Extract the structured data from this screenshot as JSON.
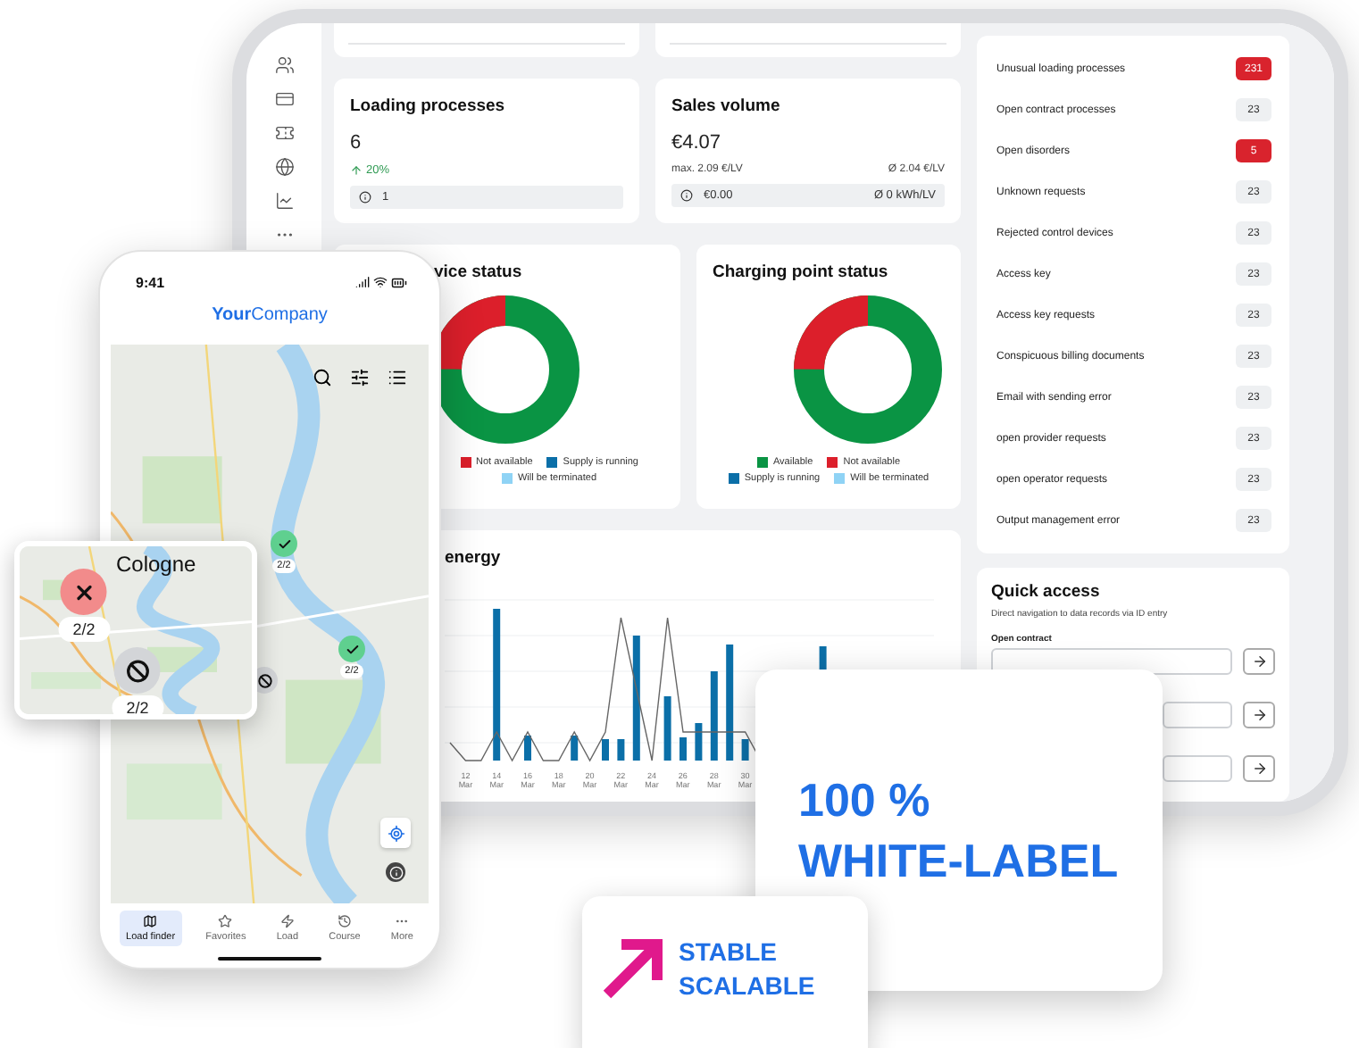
{
  "tablet": {
    "loading": {
      "title": "Loading processes",
      "value": "6",
      "trend": "20%",
      "info": "1"
    },
    "sales": {
      "title": "Sales volume",
      "value": "€4.07",
      "max": "max. 2.09 €/LV",
      "avg": "Ø 2.04 €/LV",
      "info": "€0.00",
      "info_avg": "Ø 0 kWh/LV"
    },
    "device_status": {
      "title": "vice status",
      "legend": [
        {
          "label": "Not available",
          "color": "#dc1f2b"
        },
        {
          "label": "Supply is running",
          "color": "#0b6fa8"
        },
        {
          "label": "Will be terminated",
          "color": "#8fd3f5"
        }
      ]
    },
    "charging_status": {
      "title": "Charging point status",
      "legend": [
        {
          "label": "Available",
          "color": "#0a9444"
        },
        {
          "label": "Not available",
          "color": "#dc1f2b"
        },
        {
          "label": "Supply is running",
          "color": "#0b6fa8"
        },
        {
          "label": "Will be terminated",
          "color": "#8fd3f5"
        }
      ]
    },
    "energy": {
      "title": "energy",
      "x_labels": [
        {
          "day": "12",
          "month": "Mar"
        },
        {
          "day": "14",
          "month": "Mar"
        },
        {
          "day": "16",
          "month": "Mar"
        },
        {
          "day": "18",
          "month": "Mar"
        },
        {
          "day": "20",
          "month": "Mar"
        },
        {
          "day": "22",
          "month": "Mar"
        },
        {
          "day": "24",
          "month": "Mar"
        },
        {
          "day": "26",
          "month": "Mar"
        },
        {
          "day": "28",
          "month": "Mar"
        },
        {
          "day": "30",
          "month": "Mar"
        }
      ]
    },
    "issues": [
      {
        "label": "Unusual loading processes",
        "count": "231",
        "alert": true
      },
      {
        "label": "Open contract processes",
        "count": "23",
        "alert": false
      },
      {
        "label": "Open disorders",
        "count": "5",
        "alert": true
      },
      {
        "label": "Unknown requests",
        "count": "23",
        "alert": false
      },
      {
        "label": "Rejected control devices",
        "count": "23",
        "alert": false
      },
      {
        "label": "Access key",
        "count": "23",
        "alert": false
      },
      {
        "label": "Access key requests",
        "count": "23",
        "alert": false
      },
      {
        "label": "Conspicuous billing documents",
        "count": "23",
        "alert": false
      },
      {
        "label": "Email with sending error",
        "count": "23",
        "alert": false
      },
      {
        "label": "open provider requests",
        "count": "23",
        "alert": false
      },
      {
        "label": "open operator requests",
        "count": "23",
        "alert": false
      },
      {
        "label": "Output management error",
        "count": "23",
        "alert": false
      }
    ],
    "quick_access": {
      "title": "Quick access",
      "subtitle": "Direct navigation to data records via ID entry",
      "fields": [
        {
          "kind": "labeled",
          "label": "Open contract"
        },
        {
          "kind": "plain"
        },
        {
          "kind": "plain"
        }
      ]
    }
  },
  "phone": {
    "time": "9:41",
    "logo": "**Your**Company",
    "markers": [
      {
        "kind": "ok",
        "count": "2/2"
      },
      {
        "kind": "ok",
        "count": "2/2"
      },
      {
        "kind": "blocked"
      }
    ],
    "nav": [
      {
        "label": "Load finder",
        "selected": true
      },
      {
        "label": "Favorites",
        "selected": false
      },
      {
        "label": "Load",
        "selected": false
      },
      {
        "label": "Course",
        "selected": false
      },
      {
        "label": "More",
        "selected": false
      }
    ]
  },
  "zoom_card": {
    "title": "Cologne",
    "markers": [
      {
        "kind": "error",
        "count": "2/2"
      },
      {
        "kind": "blocked",
        "count": "2/2"
      }
    ]
  },
  "white_label": {
    "lines": [
      "100 %",
      "WHITE-LABEL"
    ]
  },
  "stable_card": {
    "lines": [
      "STABLE",
      "SCALABLE"
    ]
  }
}
